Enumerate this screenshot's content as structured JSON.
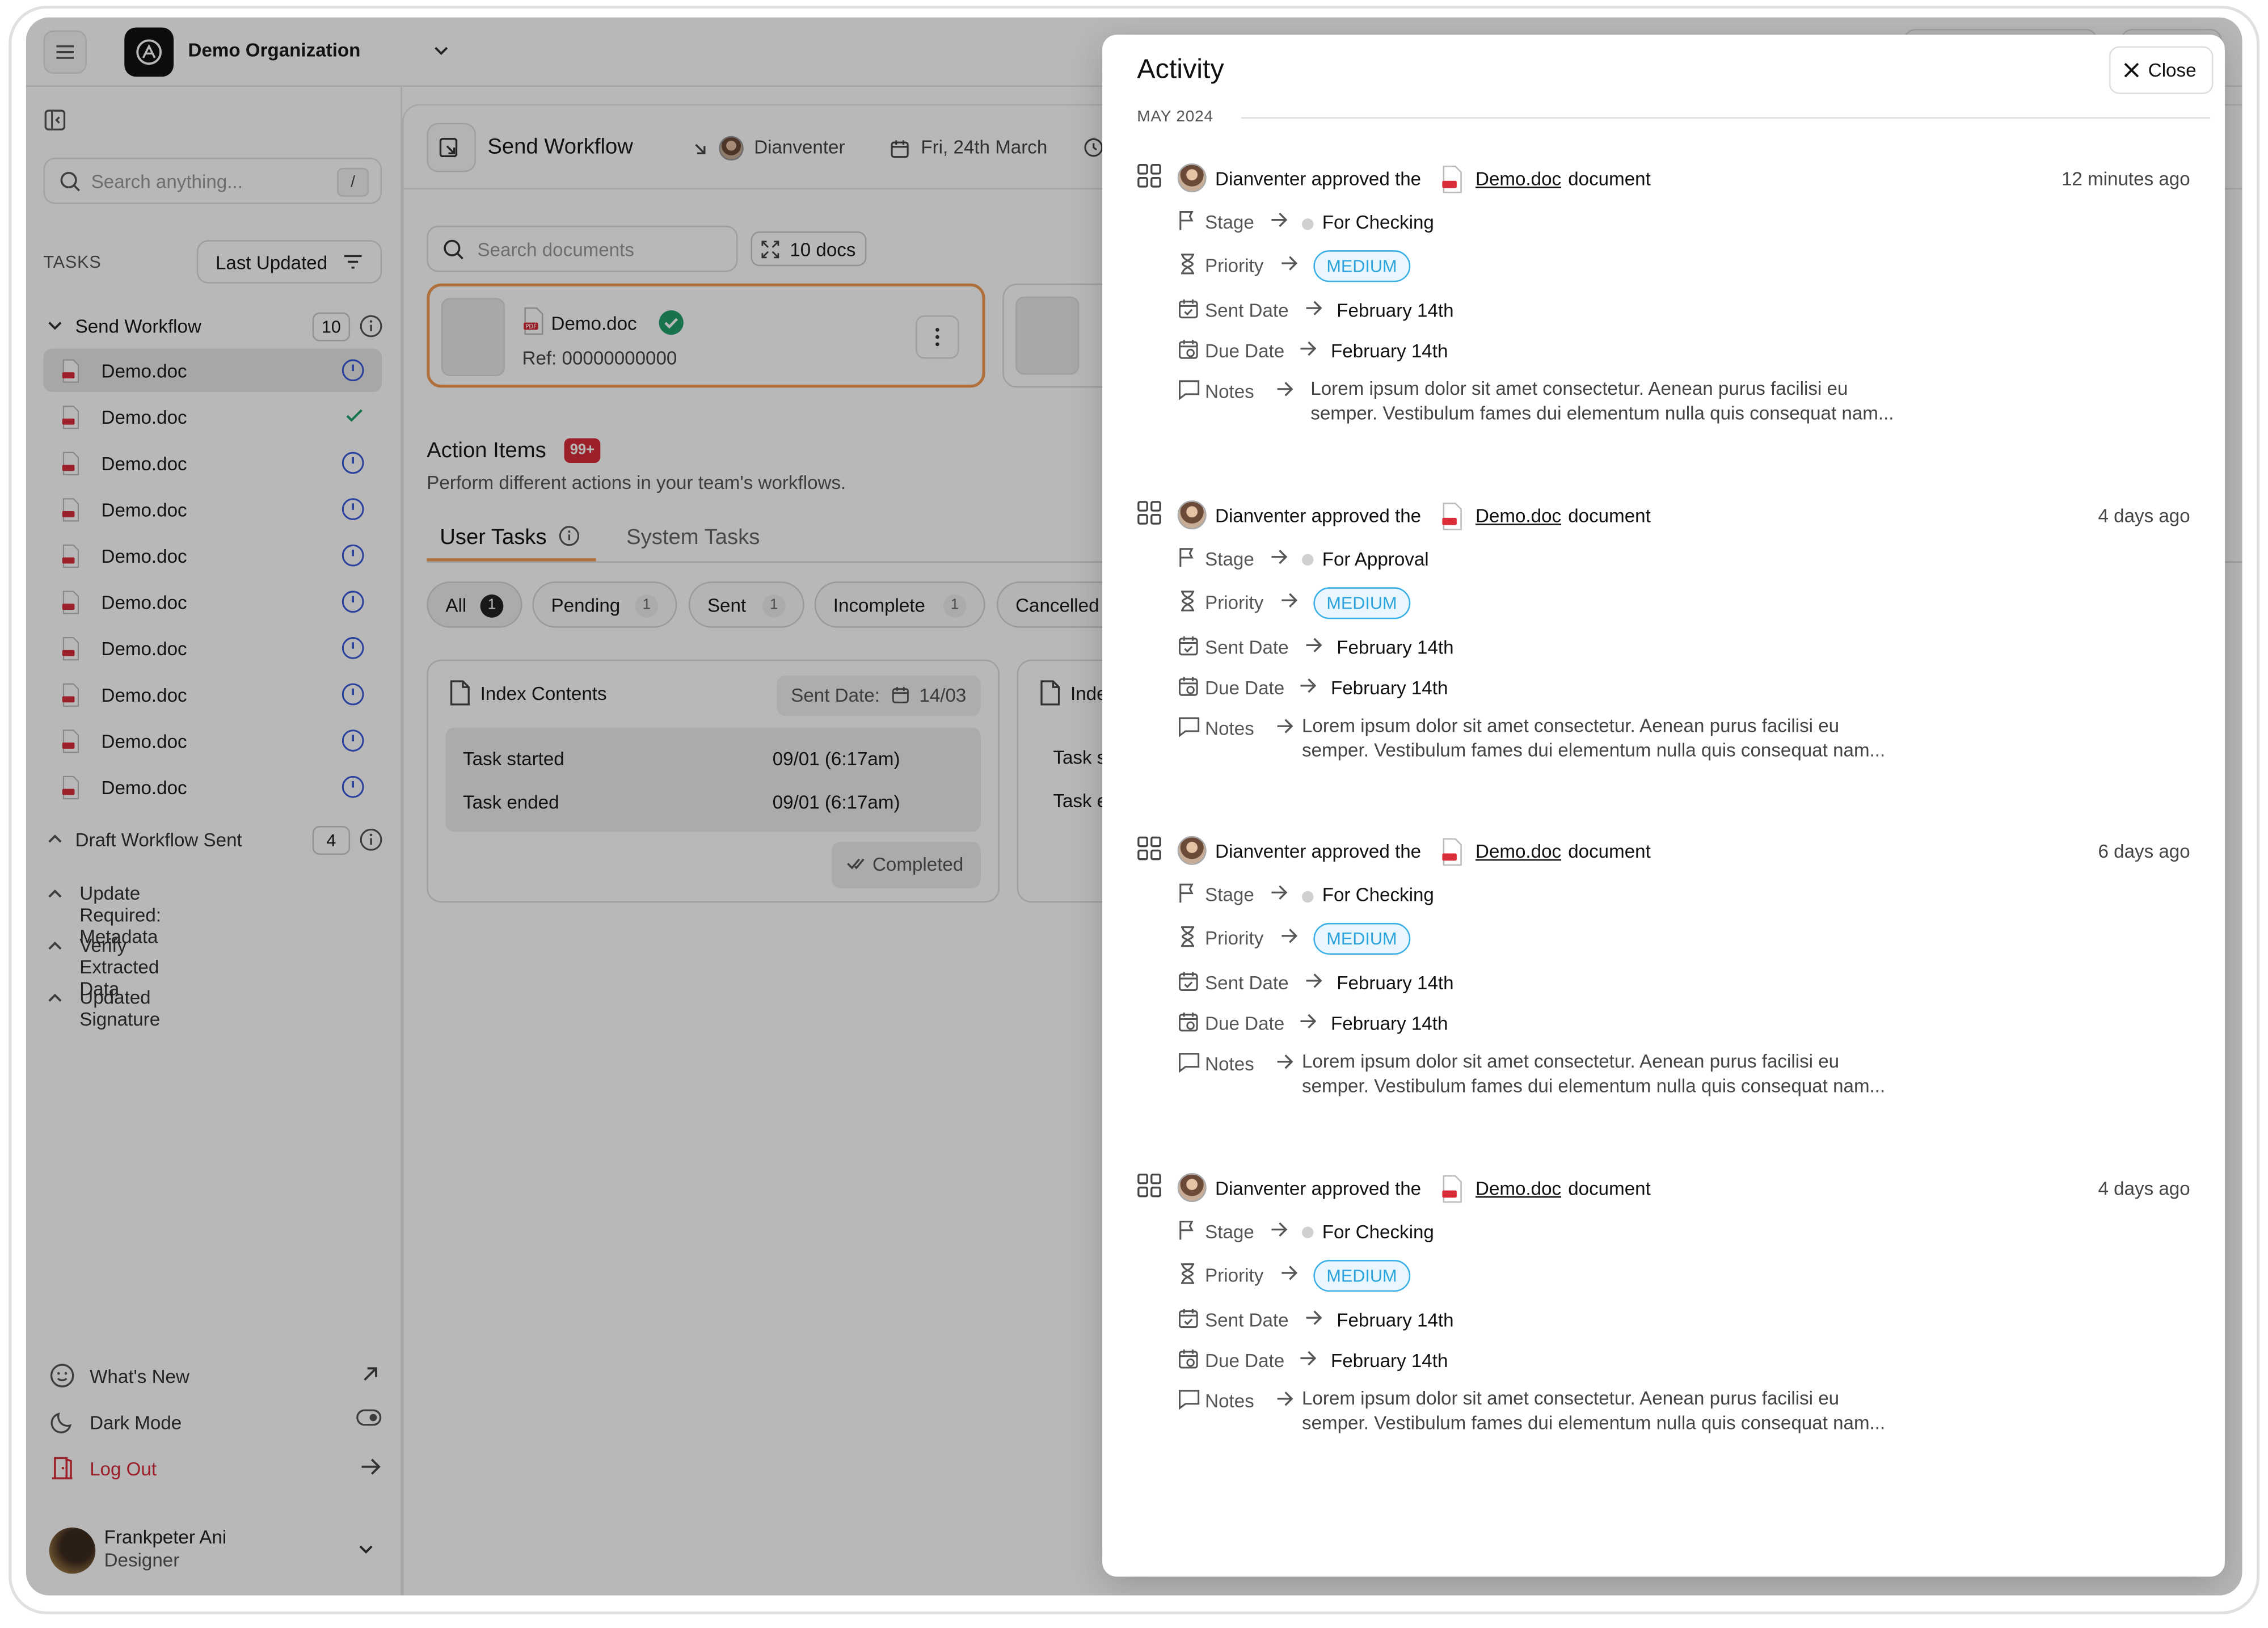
{
  "topbar": {
    "org_name": "Demo Organization"
  },
  "sidebar": {
    "search_placeholder": "Search anything...",
    "search_shortcut": "/",
    "tasks_label": "TASKS",
    "sort_label": "Last Updated",
    "workflow": {
      "name": "Send Workflow",
      "count": "10"
    },
    "docs": [
      "Demo.doc",
      "Demo.doc",
      "Demo.doc",
      "Demo.doc",
      "Demo.doc",
      "Demo.doc",
      "Demo.doc",
      "Demo.doc",
      "Demo.doc",
      "Demo.doc"
    ],
    "doc_status": [
      "pending",
      "approved",
      "pending",
      "pending",
      "pending",
      "pending",
      "pending",
      "pending",
      "pending",
      "pending"
    ],
    "draft_group": {
      "name": "Draft Workflow Sent",
      "count": "4"
    },
    "groups": [
      "Update Required: Metadata",
      "Verify Extracted Data",
      "Updated Signature"
    ],
    "footer": {
      "whats_new": "What's New",
      "dark_mode": "Dark Mode",
      "log_out": "Log Out"
    },
    "user": {
      "name": "Frankpeter Ani",
      "role": "Designer"
    }
  },
  "main": {
    "title": "Send Workflow",
    "assignee": "Dianventer",
    "date": "Fri, 24th March",
    "doc_search_placeholder": "Search documents",
    "docs_count": "10 docs",
    "doc_card": {
      "name": "Demo.doc",
      "ref": "Ref: 00000000000"
    },
    "action_items": {
      "title": "Action Items",
      "badge": "99+",
      "subtitle": "Perform different actions in your team's workflows."
    },
    "tabs": [
      "User Tasks",
      "System Tasks"
    ],
    "filters": [
      {
        "label": "All",
        "count": "1"
      },
      {
        "label": "Pending",
        "count": "1"
      },
      {
        "label": "Sent",
        "count": "1"
      },
      {
        "label": "Incomplete",
        "count": "1"
      },
      {
        "label": "Cancelled",
        "count": ""
      }
    ],
    "task_card": {
      "title": "Index Contents",
      "sent_date_label": "Sent Date:",
      "sent_date": "14/03",
      "rows": [
        {
          "label": "Task started",
          "value": "09/01 (6:17am)"
        },
        {
          "label": "Task ended",
          "value": "09/01 (6:17am)"
        }
      ],
      "status": "Completed"
    },
    "task_card2": {
      "title": "Inde",
      "row1": "Task s",
      "row2": "Task e"
    }
  },
  "activity": {
    "title": "Activity",
    "close_label": "Close",
    "month": "MAY 2024",
    "entries": [
      {
        "actor": "Dianventer",
        "action": "approved the",
        "doc": "Demo.doc",
        "doc_word": "document",
        "time": "12 minutes ago",
        "stage": "For Checking",
        "priority": "MEDIUM",
        "sent_date": "February 14th",
        "due_date": "February 14th",
        "notes": "Lorem ipsum dolor sit amet consectetur. Aenean purus facilisi eu semper. Vestibulum fames dui elementum nulla quis consequat nam..."
      },
      {
        "actor": "Dianventer",
        "action": "approved the",
        "doc": "Demo.doc",
        "doc_word": "document",
        "time": "4 days ago",
        "stage": "For Approval",
        "priority": "MEDIUM",
        "sent_date": "February 14th",
        "due_date": "February 14th",
        "notes": "Lorem ipsum dolor sit amet consectetur. Aenean purus facilisi eu semper. Vestibulum fames dui elementum nulla quis consequat nam..."
      },
      {
        "actor": "Dianventer",
        "action": "approved the",
        "doc": "Demo.doc",
        "doc_word": "document",
        "time": "6 days ago",
        "stage": "For Checking",
        "priority": "MEDIUM",
        "sent_date": "February 14th",
        "due_date": "February 14th",
        "notes": "Lorem ipsum dolor sit amet consectetur. Aenean purus facilisi eu semper. Vestibulum fames dui elementum nulla quis consequat nam..."
      },
      {
        "actor": "Dianventer",
        "action": "approved the",
        "doc": "Demo.doc",
        "doc_word": "document",
        "time": "4 days ago",
        "stage": "For Checking",
        "priority": "MEDIUM",
        "sent_date": "February 14th",
        "due_date": "February 14th",
        "notes": "Lorem ipsum dolor sit amet consectetur. Aenean purus facilisi eu semper. Vestibulum fames dui elementum nulla quis consequat nam..."
      }
    ],
    "field_labels": {
      "stage": "Stage",
      "priority": "Priority",
      "sent_date": "Sent Date",
      "due_date": "Due Date",
      "notes": "Notes"
    }
  },
  "colors": {
    "accent": "#f39c52",
    "badge_red": "#d92d3a",
    "priority_blue": "#2aa3dc",
    "approved_green": "#22a06b",
    "pending_blue": "#3b5bdb",
    "logout_red": "#d92d3a"
  },
  "icons": [
    "menu-icon",
    "chevron-down-icon",
    "sidebar-toggle-icon",
    "search-icon",
    "filter-icon",
    "info-icon",
    "pdf-icon",
    "check-icon",
    "clock-badge-icon",
    "smile-icon",
    "arrow-up-right-icon",
    "moon-icon",
    "toggle-icon",
    "door-icon",
    "arrow-right-icon",
    "calendar-icon",
    "expand-icon",
    "kebab-icon",
    "file-icon",
    "double-check-icon",
    "close-icon",
    "grid-icon",
    "flag-icon",
    "hourglass-icon",
    "calendar-check-icon",
    "calendar-clock-icon",
    "message-icon"
  ]
}
